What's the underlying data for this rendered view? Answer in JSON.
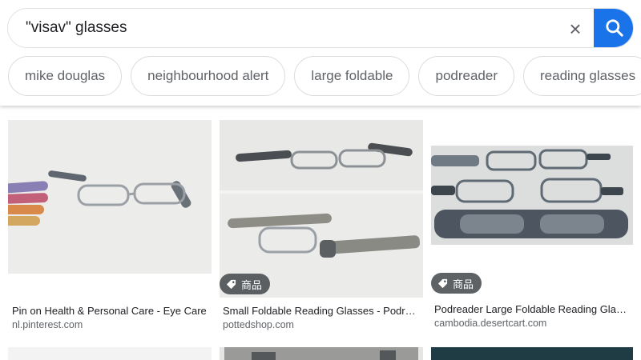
{
  "search": {
    "query": "\"visav\" glasses",
    "clear_icon": "close-icon",
    "search_icon": "search-icon",
    "accent": "#1a73e8"
  },
  "chips": [
    {
      "label": "mike douglas"
    },
    {
      "label": "neighbourhood alert"
    },
    {
      "label": "large foldable"
    },
    {
      "label": "podreader"
    },
    {
      "label": "reading glasses"
    }
  ],
  "results": [
    {
      "title": "Pin on Health & Personal Care - Eye Care",
      "source": "nl.pinterest.com",
      "tag": ""
    },
    {
      "title": "Small Foldable Reading Glasses - Podread...",
      "source": "pottedshop.com",
      "tag": "商品"
    },
    {
      "title": "Podreader Large Foldable Reading Glasse...",
      "source": "cambodia.desertcart.com",
      "tag": "商品"
    }
  ]
}
